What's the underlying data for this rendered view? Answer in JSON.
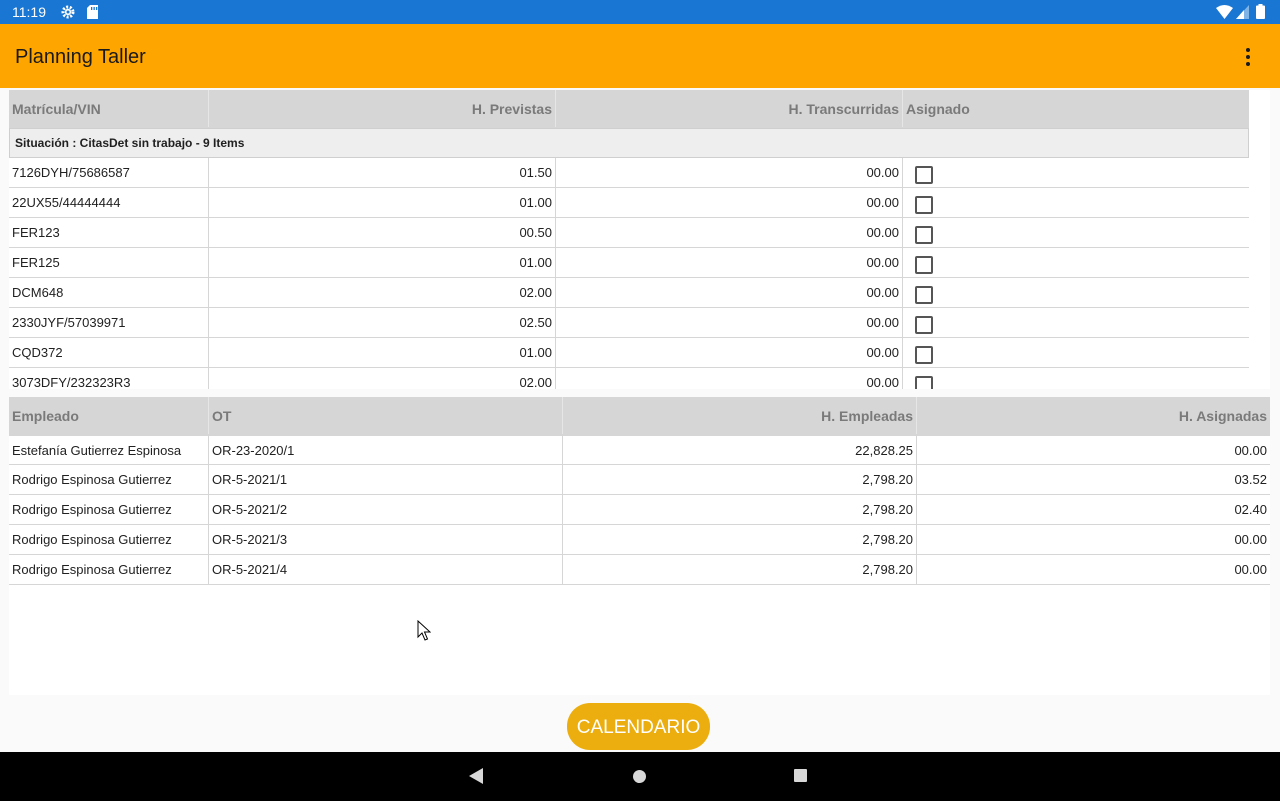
{
  "status_bar": {
    "time": "11:19"
  },
  "app_bar": {
    "title": "Planning Taller"
  },
  "vehicles_table": {
    "headers": {
      "plate": "Matrícula/VIN",
      "planned": "H. Previstas",
      "elapsed": "H. Transcurridas",
      "assigned": "Asignado"
    },
    "group_label": "Situación : CitasDet sin trabajo - 9 Items",
    "rows": [
      {
        "plate": "7126DYH/75686587",
        "planned": "01.50",
        "elapsed": "00.00",
        "assigned": false
      },
      {
        "plate": "22UX55/44444444",
        "planned": "01.00",
        "elapsed": "00.00",
        "assigned": false
      },
      {
        "plate": "FER123",
        "planned": "00.50",
        "elapsed": "00.00",
        "assigned": false
      },
      {
        "plate": "FER125",
        "planned": "01.00",
        "elapsed": "00.00",
        "assigned": false
      },
      {
        "plate": "DCM648",
        "planned": "02.00",
        "elapsed": "00.00",
        "assigned": false
      },
      {
        "plate": "2330JYF/57039971",
        "planned": "02.50",
        "elapsed": "00.00",
        "assigned": false
      },
      {
        "plate": "CQD372",
        "planned": "01.00",
        "elapsed": "00.00",
        "assigned": false
      },
      {
        "plate": "3073DFY/232323R3",
        "planned": "02.00",
        "elapsed": "00.00",
        "assigned": false
      }
    ]
  },
  "employees_table": {
    "headers": {
      "employee": "Empleado",
      "ot": "OT",
      "used": "H. Empleadas",
      "assigned": "H. Asignadas"
    },
    "rows": [
      {
        "employee": "Estefanía Gutierrez Espinosa",
        "ot": "OR-23-2020/1",
        "used": "22,828.25",
        "assigned": "00.00"
      },
      {
        "employee": "Rodrigo Espinosa Gutierrez",
        "ot": "OR-5-2021/1",
        "used": "2,798.20",
        "assigned": "03.52"
      },
      {
        "employee": "Rodrigo Espinosa Gutierrez",
        "ot": "OR-5-2021/2",
        "used": "2,798.20",
        "assigned": "02.40"
      },
      {
        "employee": "Rodrigo Espinosa Gutierrez",
        "ot": "OR-5-2021/3",
        "used": "2,798.20",
        "assigned": "00.00"
      },
      {
        "employee": "Rodrigo Espinosa Gutierrez",
        "ot": "OR-5-2021/4",
        "used": "2,798.20",
        "assigned": "00.00"
      }
    ]
  },
  "calendar_button": {
    "label": "CALENDARIO"
  },
  "colors": {
    "status_bar": "#1976d2",
    "app_bar": "#ffa500",
    "button": "#ebae0e",
    "logo_accent": "#e53935"
  },
  "icons": [
    "settings-icon",
    "sd-card-icon",
    "wifi-icon",
    "signal-icon",
    "battery-icon",
    "app-logo-icon",
    "overflow-menu-icon",
    "back-icon",
    "home-icon",
    "recents-icon",
    "mouse-cursor-icon"
  ]
}
